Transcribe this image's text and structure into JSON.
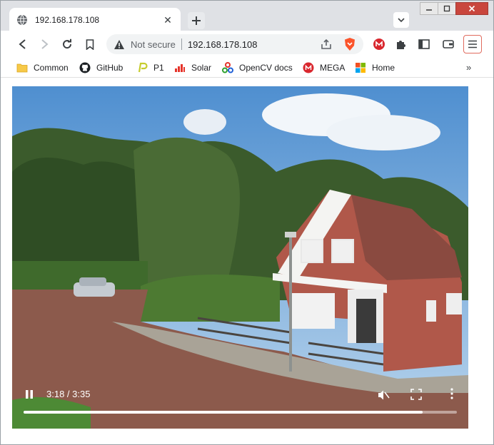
{
  "tab": {
    "title": "192.168.178.108",
    "close_label": "✕"
  },
  "omnibox": {
    "security_label": "Not secure",
    "url": "192.168.178.108"
  },
  "bookmarks": [
    {
      "label": "Common",
      "icon": "folder-icon"
    },
    {
      "label": "GitHub",
      "icon": "github-icon"
    },
    {
      "label": "P1",
      "icon": "p1-icon"
    },
    {
      "label": "Solar",
      "icon": "solar-icon"
    },
    {
      "label": "OpenCV docs",
      "icon": "opencv-icon"
    },
    {
      "label": "MEGA",
      "icon": "mega-icon"
    },
    {
      "label": "Home",
      "icon": "home-icon"
    }
  ],
  "bookmarks_more": "»",
  "video": {
    "time": "3:18 / 3:35",
    "progress": 0.9209,
    "state": "playing"
  },
  "colors": {
    "accent": "#e06b5e",
    "close_red": "#c9463d",
    "mega_red": "#d9272e"
  }
}
